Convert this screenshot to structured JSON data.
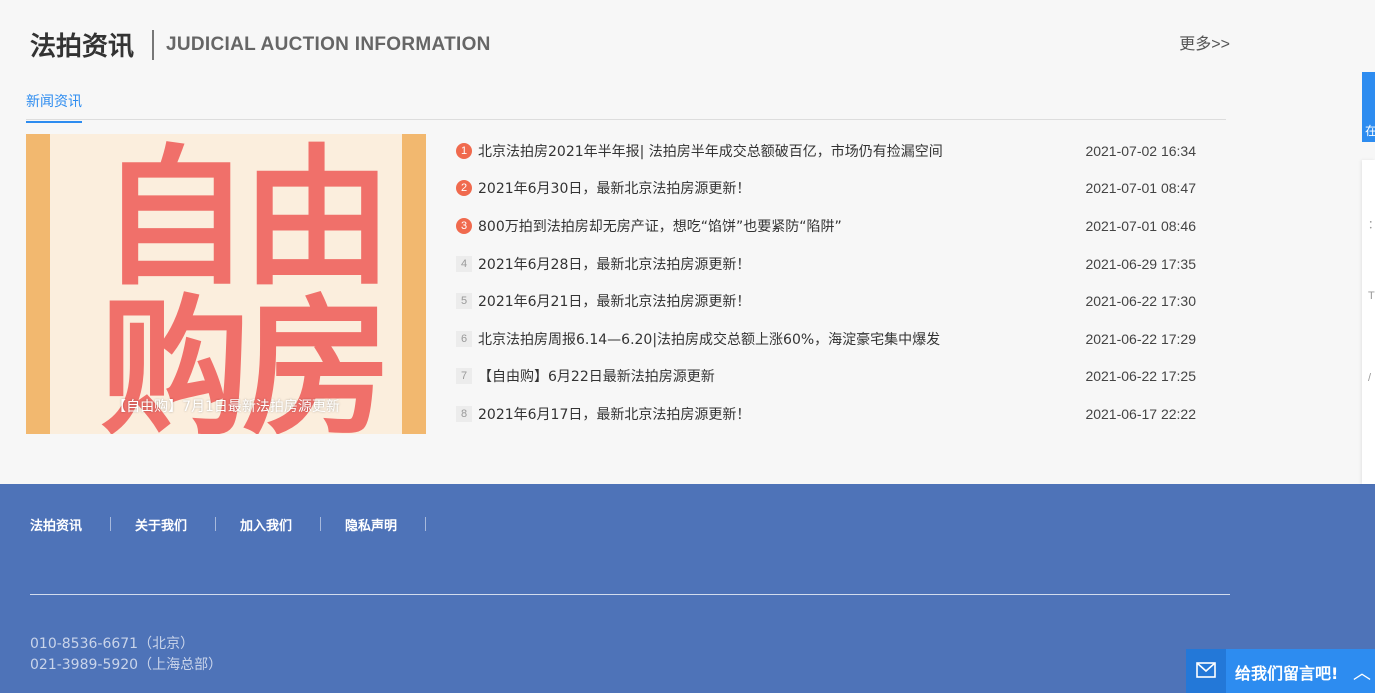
{
  "section": {
    "title_cn": "法拍资讯",
    "title_en": "JUDICIAL AUCTION INFORMATION",
    "more_label": "更多>>"
  },
  "tabs": [
    {
      "label": "新闻资讯",
      "active": true
    }
  ],
  "feature": {
    "poster_line1": "自由",
    "poster_line2": "购房",
    "caption": "【自由购】7月1日最新法拍房源更新"
  },
  "news": [
    {
      "rank": "1",
      "title": "北京法拍房2021年半年报| 法拍房半年成交总额破百亿，市场仍有捡漏空间",
      "date": "2021-07-02 16:34"
    },
    {
      "rank": "2",
      "title": "2021年6月30日，最新北京法拍房源更新！",
      "date": "2021-07-01 08:47"
    },
    {
      "rank": "3",
      "title": "800万拍到法拍房却无房产证，想吃“馅饼”也要紧防“陷阱”",
      "date": "2021-07-01 08:46"
    },
    {
      "rank": "4",
      "title": "2021年6月28日，最新北京法拍房源更新！",
      "date": "2021-06-29 17:35"
    },
    {
      "rank": "5",
      "title": "2021年6月21日，最新北京法拍房源更新！",
      "date": "2021-06-22 17:30"
    },
    {
      "rank": "6",
      "title": "北京法拍房周报6.14—6.20|法拍房成交总额上涨60%，海淀豪宅集中爆发",
      "date": "2021-06-22 17:29"
    },
    {
      "rank": "7",
      "title": "【自由购】6月22日最新法拍房源更新",
      "date": "2021-06-22 17:25"
    },
    {
      "rank": "8",
      "title": "2021年6月17日，最新北京法拍房源更新！",
      "date": "2021-06-17 22:22"
    }
  ],
  "footer": {
    "links": [
      "法拍资讯",
      "关于我们",
      "加入我们",
      "隐私声明"
    ],
    "phone_beijing": "010-8536-6671（北京）",
    "phone_shanghai": "021-3989-5920（上海总部）"
  },
  "side": {
    "tab_text": "在",
    "marks": [
      "：",
      "T",
      "/"
    ]
  },
  "chat": {
    "label": "给我们留言吧!",
    "icon": "mail-icon",
    "arrow": "︿"
  },
  "colors": {
    "accent": "#2d8cf0",
    "footer_bg": "#4e73b8",
    "hot_rank": "#f06a4e",
    "poster_text": "#f0706a"
  }
}
